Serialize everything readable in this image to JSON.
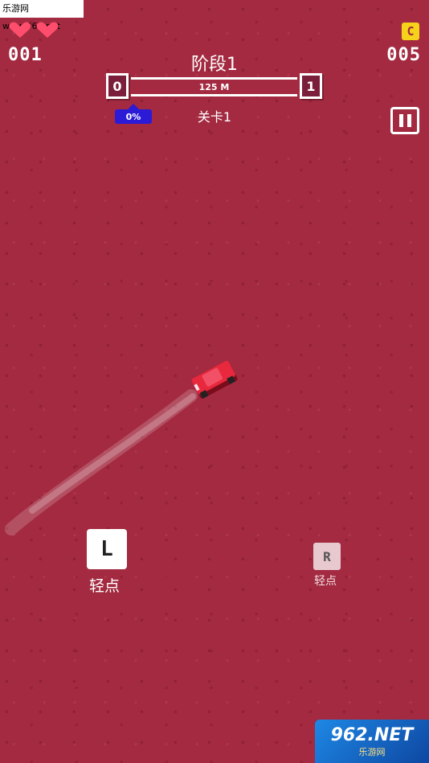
{
  "watermark_top": "乐游网 www.962.net",
  "lives": {
    "icon": "heart-icon",
    "count": 2,
    "color": "#ff4d6d"
  },
  "score_left": "001",
  "coins": {
    "icon": "coin-icon",
    "glyph": "C",
    "value": "005",
    "color": "#f7d21a"
  },
  "stage": {
    "title": "阶段1",
    "start_level": "0",
    "end_level": "1",
    "distance": "125 M",
    "progress_pct": 0,
    "progress_label": "0%",
    "level_label": "关卡1"
  },
  "pause": {
    "icon": "pause-icon"
  },
  "controls": {
    "left": {
      "glyph": "L",
      "label": "轻点"
    },
    "right": {
      "glyph": "R",
      "label": "轻点"
    }
  },
  "watermark_bottom": {
    "main": "962.NET",
    "sub": "乐游网"
  },
  "colors": {
    "background": "#a32a40",
    "badge": "#2b1bd6",
    "car": "#e8283c"
  }
}
